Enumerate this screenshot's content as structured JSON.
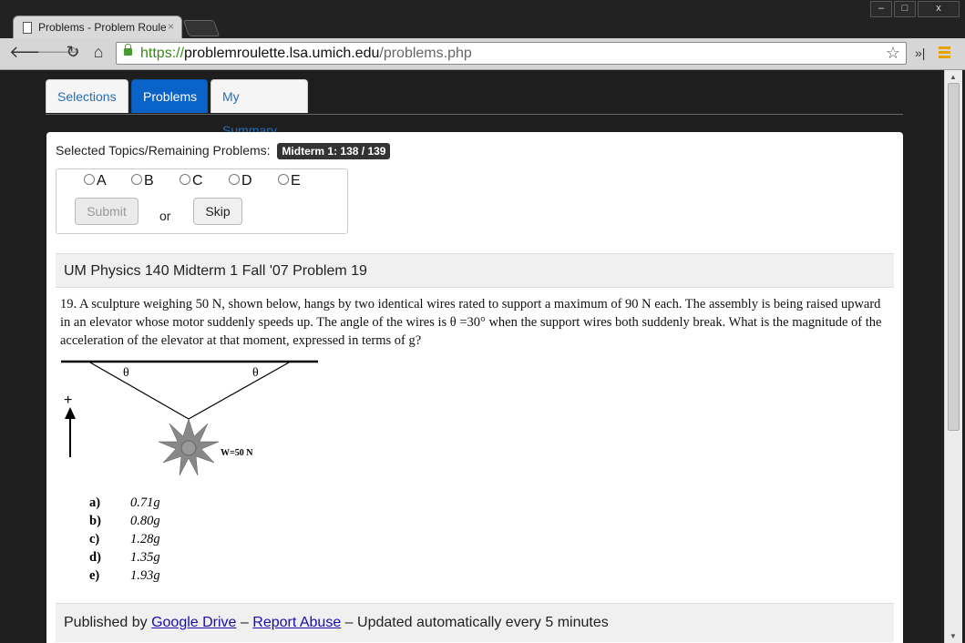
{
  "browser": {
    "tab_title": "Problems - Problem Roulette",
    "tab_close": "×",
    "url_scheme": "https://",
    "url_host": "problemroulette.lsa.umich.edu",
    "url_path": "/problems.php",
    "window_buttons": [
      "–",
      "□",
      "x"
    ]
  },
  "nav": {
    "tabs": [
      {
        "label": "Selections"
      },
      {
        "label": "Problems"
      },
      {
        "label": "My Summary"
      }
    ],
    "active_tab": "Problems"
  },
  "selection": {
    "label": "Selected Topics/Remaining Problems:",
    "badge": "Midterm 1:  138 / 139"
  },
  "answers": {
    "options": [
      "A",
      "B",
      "C",
      "D",
      "E"
    ],
    "submit_label": "Submit",
    "or_label": "or",
    "skip_label": "Skip"
  },
  "problem": {
    "heading": "UM Physics 140 Midterm 1 Fall '07 Problem 19",
    "text": "19.  A sculpture weighing 50 N, shown below, hangs by two identical wires rated to support a maximum of 90 N each.  The assembly is being raised upward in an elevator whose motor suddenly speeds up.  The angle of the wires is θ =30° when the support wires both suddenly break.  What is the magnitude of the acceleration of the elevator at that moment, expressed in terms of g?",
    "figure": {
      "theta_left": "θ",
      "theta_right": "θ",
      "plus": "+",
      "weight": "W=50 N"
    },
    "choices": [
      {
        "label": "a)",
        "value": "0.71g"
      },
      {
        "label": "b)",
        "value": "0.80g"
      },
      {
        "label": "c)",
        "value": "1.28g"
      },
      {
        "label": "d)",
        "value": "1.35g"
      },
      {
        "label": "e)",
        "value": "1.93g"
      }
    ]
  },
  "footer": {
    "published_by": "Published by",
    "google_drive": "Google Drive",
    "sep1": "–",
    "report_abuse": "Report Abuse",
    "sep2": "–",
    "updated": "Updated automatically every 5 minutes"
  }
}
